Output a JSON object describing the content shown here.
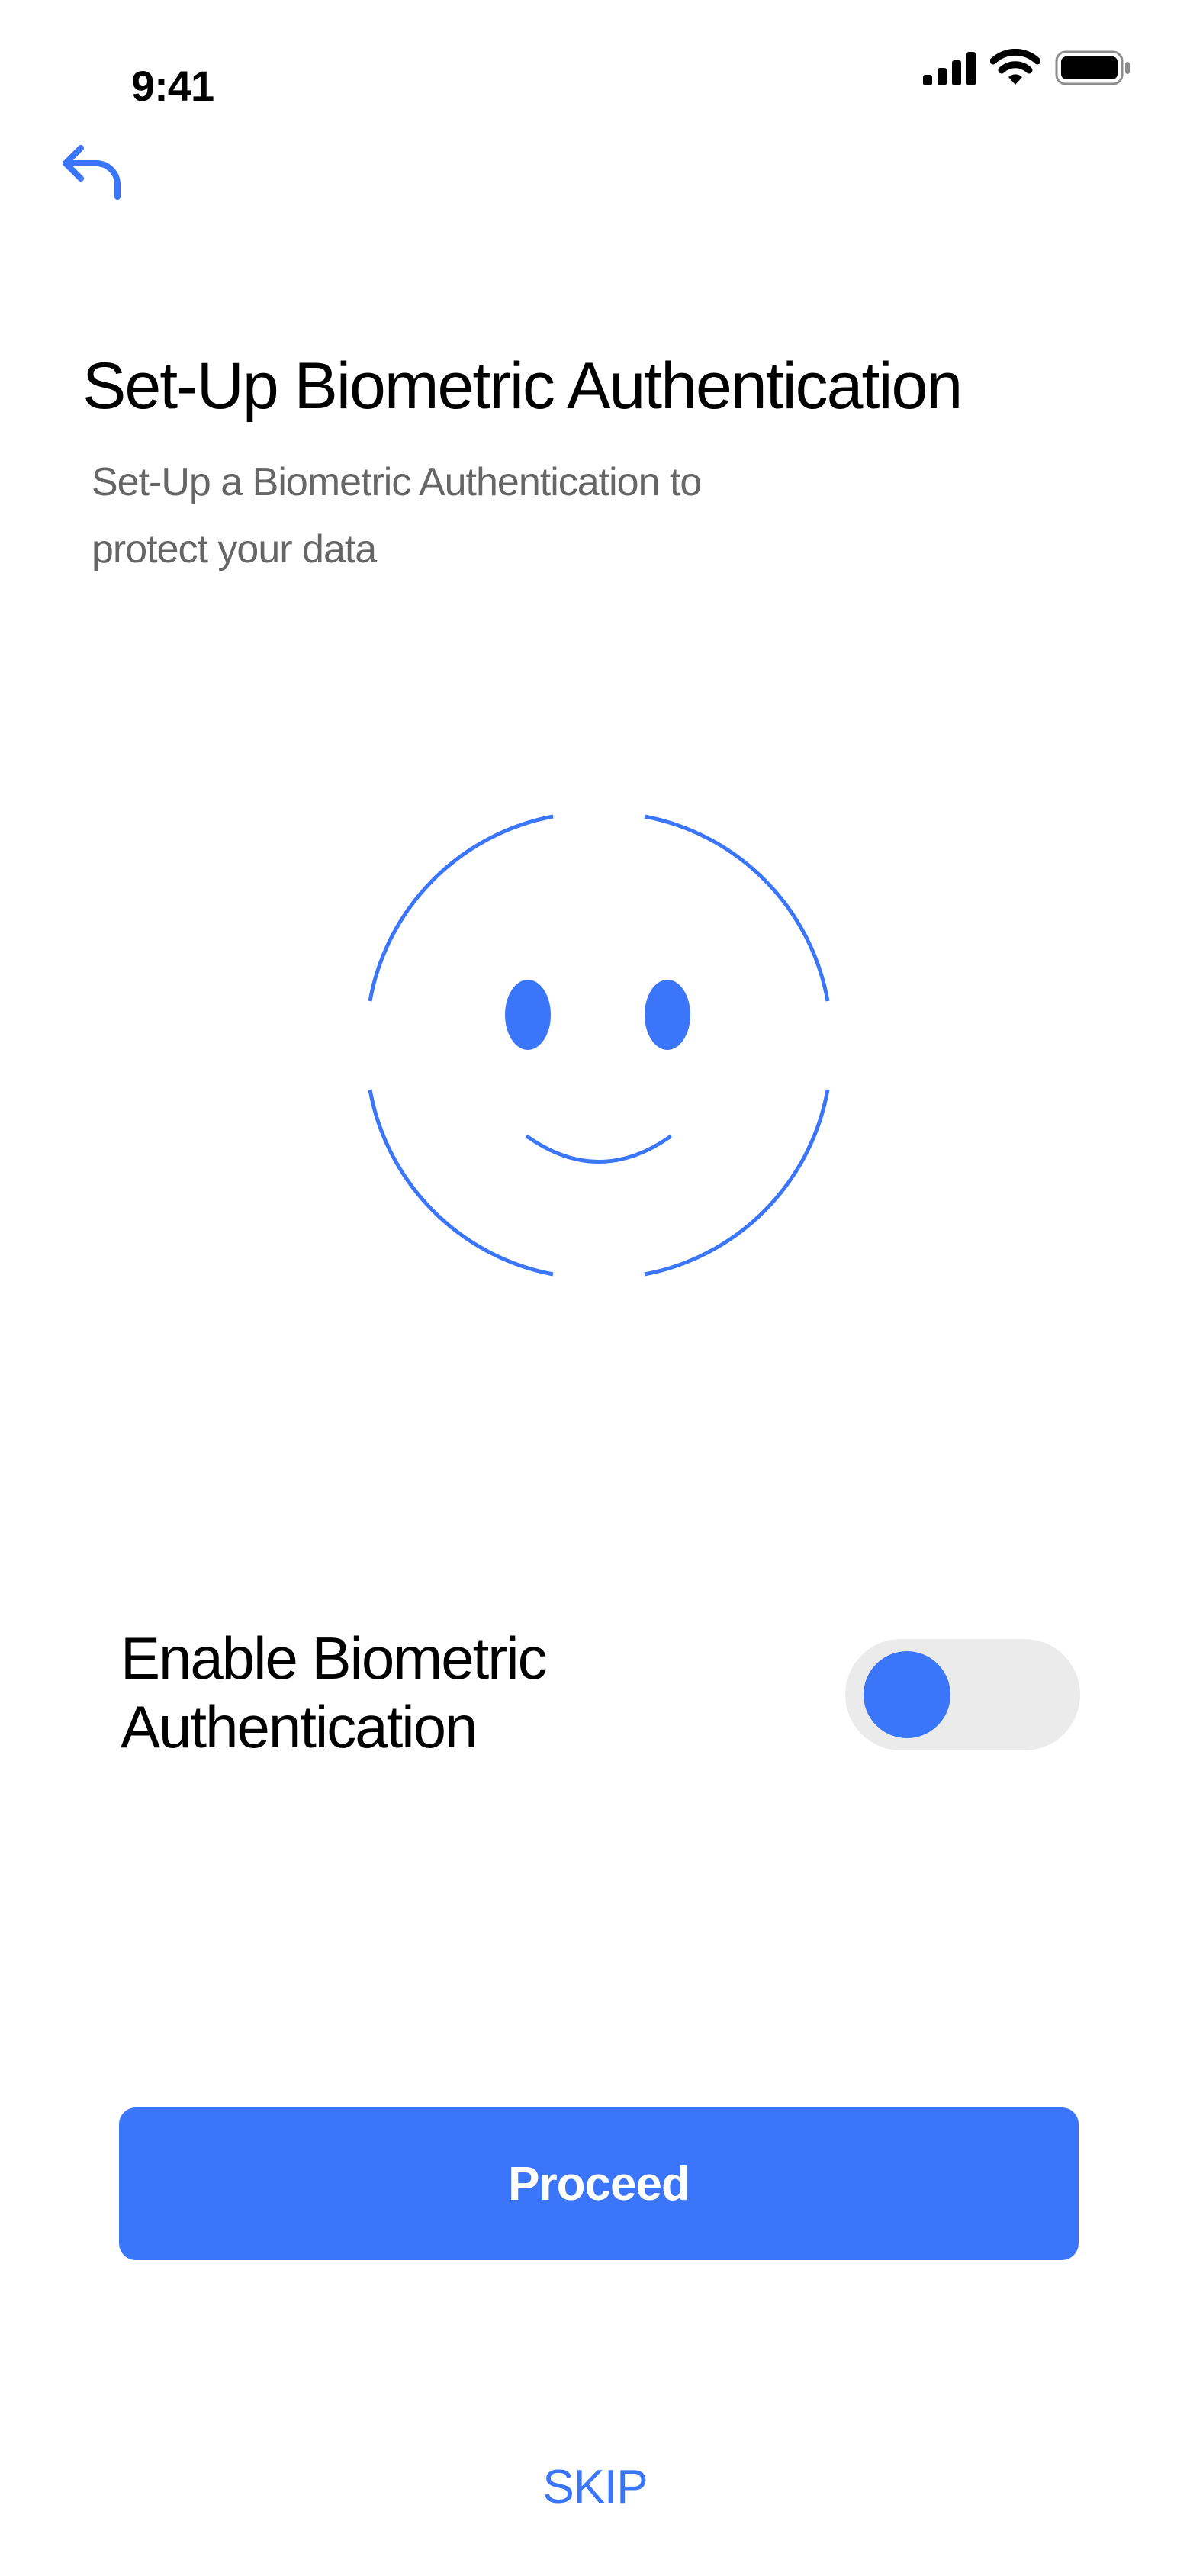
{
  "status_bar": {
    "time": "9:41",
    "icons": [
      "cellular-signal-icon",
      "wifi-icon",
      "battery-icon"
    ]
  },
  "navigation": {
    "back_icon": "back-arrow-icon"
  },
  "header": {
    "title": "Set-Up Biometric Authentication",
    "subtitle": "Set-Up a Biometric Authentication  to protect your data"
  },
  "illustration": {
    "icon": "face-id-icon"
  },
  "toggle": {
    "label": "Enable Biometric Authentication",
    "enabled": false
  },
  "actions": {
    "proceed_label": "Proceed",
    "skip_label": "SKIP"
  },
  "colors": {
    "accent": "#3a75fa",
    "toggle_track": "#ebebeb",
    "subtitle_text": "#666666",
    "background": "#ffffff"
  }
}
